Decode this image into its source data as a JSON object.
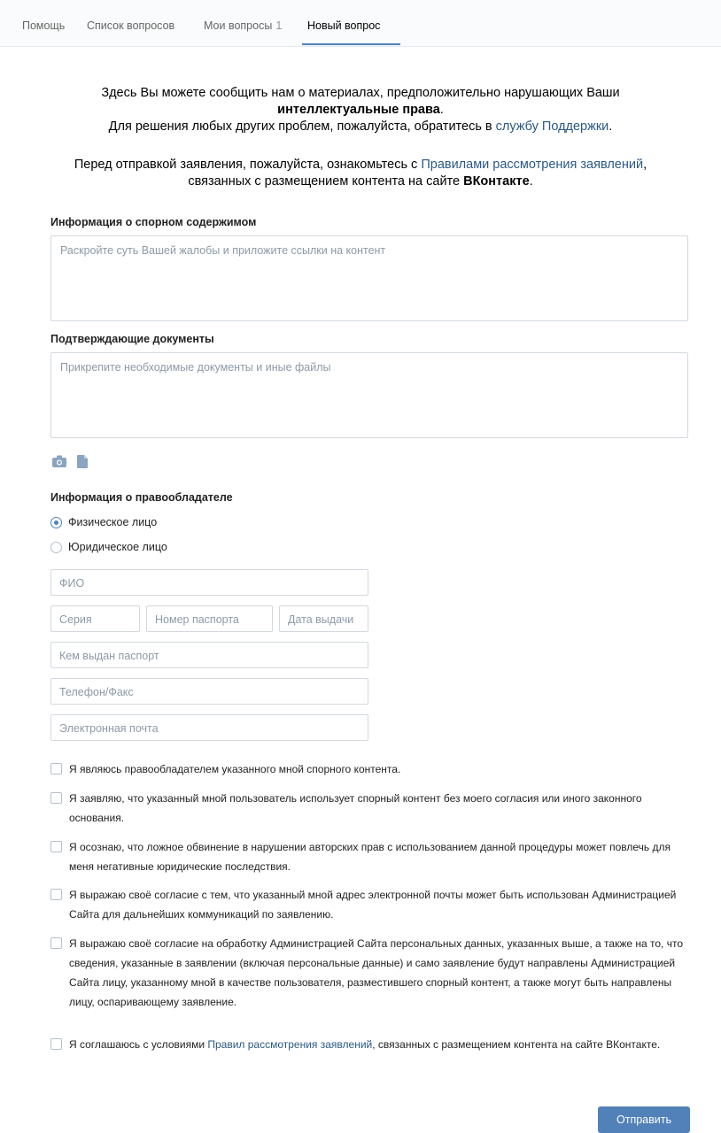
{
  "tabs": [
    {
      "label": "Помощь"
    },
    {
      "label": "Список вопросов"
    },
    {
      "label": "Мои вопросы",
      "count": "1"
    },
    {
      "label": "Новый вопрос"
    }
  ],
  "intro": {
    "line1": "Здесь Вы можете сообщить нам о материалах, предположительно нарушающих Ваши",
    "line1_bold": "интеллектуальные права",
    "line1_end": ".",
    "line2_pre": "Для решения любых других проблем, пожалуйста, обратитесь в ",
    "line2_link": "службу Поддержки",
    "line2_end": ".",
    "line3_pre": "Перед отправкой заявления, пожалуйста, ознакомьтесь с ",
    "line3_link": "Правилами рассмотрения заявлений",
    "line3_end": ",",
    "line4_pre": "связанных с размещением контента на сайте ",
    "line4_bold": "ВКонтакте",
    "line4_end": "."
  },
  "content_section": {
    "title": "Информация о спорном содержимом",
    "placeholder": "Раскройте суть Вашей жалобы и приложите ссылки на контент"
  },
  "documents_section": {
    "title": "Подтверждающие документы",
    "placeholder": "Прикрепите необходимые документы и иные файлы"
  },
  "attach_icons": [
    "camera-icon",
    "document-icon"
  ],
  "owner_section": {
    "title": "Информация о правообладателе",
    "options": [
      {
        "label": "Физическое лицо",
        "selected": true
      },
      {
        "label": "Юридическое лицо",
        "selected": false
      }
    ],
    "fields": {
      "name": "ФИО",
      "series": "Серия",
      "passport_number": "Номер паспорта",
      "issue_date": "Дата выдачи",
      "issued_by": "Кем выдан паспорт",
      "phone": "Телефон/Факс",
      "email": "Электронная почта"
    }
  },
  "agreements": [
    {
      "text": "Я являюсь правообладателем указанного мной спорного контента."
    },
    {
      "text": "Я заявляю, что указанный мной пользователь использует спорный контент без моего согласия или иного законного основания."
    },
    {
      "text": "Я осознаю, что ложное обвинение в нарушении авторских прав с использованием данной процедуры может повлечь для меня негативные юридические последствия."
    },
    {
      "text": "Я выражаю своё согласие с тем, что указанный мной адрес электронной почты может быть использован Администрацией Сайта для дальнейших коммуникаций по заявлению."
    },
    {
      "text": "Я выражаю своё согласие на обработку Администрацией Сайта персональных данных, указанных выше, а также на то, что сведения, указанные в заявлении (включая персональные данные) и само заявление будут направлены Администрацией Сайта лицу, указанному мной в качестве пользователя, разместившего спорный контент, а также могут быть направлены лицу, оспаривающему заявление."
    },
    {
      "text_pre": "Я соглашаюсь с условиями ",
      "text_link": "Правил рассмотрения заявлений",
      "text_post": ", связанных с размещением контента на сайте ВКонтакте."
    }
  ],
  "submit_label": "Отправить",
  "colors": {
    "accent": "#5181b8",
    "link": "#2a5885",
    "border": "#d3d9de"
  }
}
